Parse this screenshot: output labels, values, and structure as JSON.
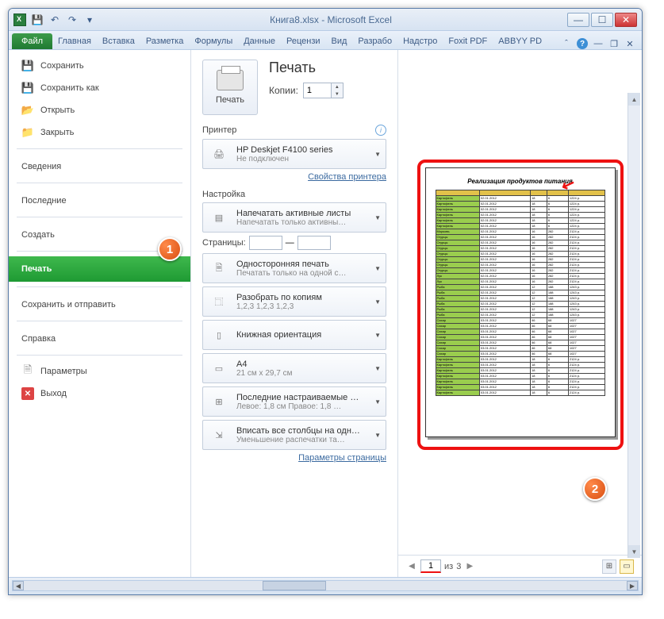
{
  "window": {
    "title": "Книга8.xlsx - Microsoft Excel"
  },
  "ribbon": {
    "file": "Файл",
    "tabs": [
      "Главная",
      "Вставка",
      "Разметка",
      "Формулы",
      "Данные",
      "Рецензи",
      "Вид",
      "Разрабо",
      "Надстро",
      "Foxit PDF",
      "ABBYY PD"
    ]
  },
  "backstage": {
    "save": "Сохранить",
    "saveas": "Сохранить как",
    "open": "Открыть",
    "close": "Закрыть",
    "info": "Сведения",
    "recent": "Последние",
    "new": "Создать",
    "print": "Печать",
    "share": "Сохранить и отправить",
    "help": "Справка",
    "options": "Параметры",
    "exit": "Выход"
  },
  "print": {
    "title": "Печать",
    "copies_label": "Копии:",
    "copies_value": "1",
    "button": "Печать",
    "printer_heading": "Принтер",
    "printer_name": "HP Deskjet F4100 series",
    "printer_status": "Не подключен",
    "printer_props": "Свойства принтера",
    "settings_heading": "Настройка",
    "active_sheets_t": "Напечатать активные листы",
    "active_sheets_s": "Напечатать только активны…",
    "pages_label": "Страницы:",
    "pages_to": "—",
    "onesided_t": "Односторонняя печать",
    "onesided_s": "Печатать только на одной с…",
    "collated_t": "Разобрать по копиям",
    "collated_s": "1,2,3   1,2,3   1,2,3",
    "orientation_t": "Книжная ориентация",
    "paper_t": "A4",
    "paper_s": "21 см x 29,7 см",
    "margins_t": "Последние настраиваемые …",
    "margins_s": "Левое: 1,8 см   Правое: 1,8 …",
    "fit_t": "Вписать все столбцы на одн…",
    "fit_s": "Уменьшение распечатки та…",
    "page_setup": "Параметры страницы"
  },
  "preview": {
    "doc_title": "Реализация продуктов питания",
    "page_current": "1",
    "page_of_label": "из",
    "page_total": "3",
    "rows": [
      [
        "Картофель",
        "02.01.2012",
        "18",
        "6",
        "1224 р."
      ],
      [
        "Картофель",
        "02.01.2012",
        "18",
        "6",
        "1224 р."
      ],
      [
        "Картофель",
        "02.01.2012",
        "18",
        "6",
        "1224 р."
      ],
      [
        "Картофель",
        "02.01.2012",
        "18",
        "6",
        "1224 р."
      ],
      [
        "Картофель",
        "02.01.2012",
        "18",
        "6",
        "1224 р."
      ],
      [
        "Картофель",
        "02.01.2012",
        "18",
        "6",
        "1224 р."
      ],
      [
        "Морковь",
        "02.01.2012",
        "16",
        "282",
        "2124 р."
      ],
      [
        "Огурцы",
        "02.01.2012",
        "16",
        "282",
        "2124 р."
      ],
      [
        "Огурцы",
        "02.01.2012",
        "16",
        "282",
        "2124 р."
      ],
      [
        "Огурцы",
        "02.01.2012",
        "16",
        "282",
        "2124 р."
      ],
      [
        "Огурцы",
        "02.01.2012",
        "16",
        "282",
        "2124 р."
      ],
      [
        "Огурцы",
        "02.01.2012",
        "16",
        "282",
        "2124 р."
      ],
      [
        "Огурцы",
        "02.01.2012",
        "16",
        "282",
        "2124 р."
      ],
      [
        "Огурцы",
        "02.01.2012",
        "16",
        "282",
        "2124 р."
      ],
      [
        "Лук",
        "02.01.2012",
        "16",
        "282",
        "2124 р."
      ],
      [
        "Лук",
        "02.01.2012",
        "16",
        "282",
        "2124 р."
      ],
      [
        "Рыба",
        "02.01.2012",
        "12",
        "188",
        "1243 р."
      ],
      [
        "Рыба",
        "02.01.2012",
        "12",
        "188",
        "1243 р."
      ],
      [
        "Рыба",
        "02.01.2012",
        "12",
        "188",
        "1243 р."
      ],
      [
        "Рыба",
        "02.01.2012",
        "12",
        "188",
        "1243 р."
      ],
      [
        "Рыба",
        "02.01.2012",
        "12",
        "188",
        "1243 р."
      ],
      [
        "Рыба",
        "02.01.2012",
        "12",
        "188",
        "1243 р."
      ],
      [
        "Сахар",
        "03.01.2012",
        "46",
        "68",
        "1027"
      ],
      [
        "Сахар",
        "03.01.2012",
        "46",
        "68",
        "1027"
      ],
      [
        "Сахар",
        "03.01.2012",
        "46",
        "68",
        "1027"
      ],
      [
        "Сахар",
        "03.01.2012",
        "46",
        "68",
        "1027"
      ],
      [
        "Сахар",
        "03.01.2012",
        "46",
        "68",
        "1027"
      ],
      [
        "Сахар",
        "03.01.2012",
        "46",
        "68",
        "1027"
      ],
      [
        "Сахар",
        "03.01.2012",
        "46",
        "68",
        "1027"
      ],
      [
        "Картофель",
        "03.01.2012",
        "18",
        "6",
        "2124 р."
      ],
      [
        "Картофель",
        "03.01.2012",
        "18",
        "6",
        "2124 р."
      ],
      [
        "Картофель",
        "03.01.2012",
        "18",
        "6",
        "2124 р."
      ],
      [
        "Картофель",
        "03.01.2012",
        "18",
        "6",
        "2124 р."
      ],
      [
        "Картофель",
        "03.01.2012",
        "18",
        "6",
        "2124 р."
      ],
      [
        "Картофель",
        "03.01.2012",
        "18",
        "6",
        "2124 р."
      ],
      [
        "Картофель",
        "03.01.2012",
        "18",
        "6",
        "2124 р."
      ]
    ]
  }
}
